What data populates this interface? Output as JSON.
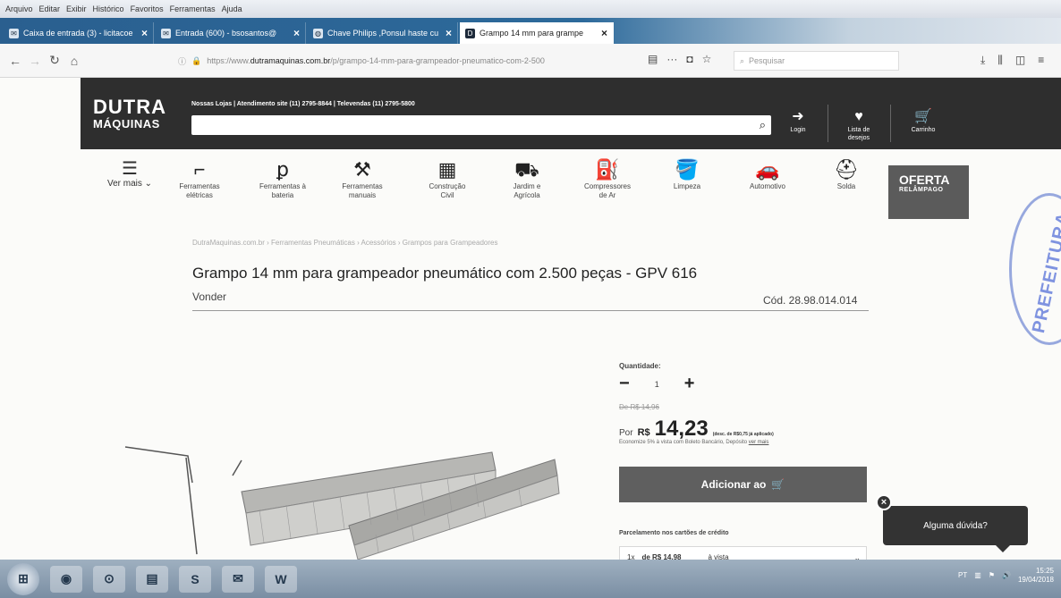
{
  "menubar": {
    "items": [
      "Arquivo",
      "Editar",
      "Exibir",
      "Histórico",
      "Favoritos",
      "Ferramentas",
      "Ajuda"
    ]
  },
  "tabs": [
    {
      "title": "Caixa de entrada (3) - licitacoe"
    },
    {
      "title": "Entrada (600) - bsosantos@"
    },
    {
      "title": "Chave Philips ,Ponsul haste cu"
    },
    {
      "title": "Grampo 14 mm para grampe"
    }
  ],
  "navbar": {
    "url_prefix": "https://www.",
    "url_domain": "dutramaquinas.com.br",
    "url_path": "/p/grampo-14-mm-para-grampeador-pneumatico-com-2-500",
    "search_placeholder": "Pesquisar"
  },
  "site": {
    "logo_line1": "DUTRA",
    "logo_line2": "MÁQUINAS",
    "toplinks": "Nossas Lojas  |  Atendimento site (11) 2795-8844  |  Televendas (11) 2795-5800",
    "search_value": "",
    "login": "Login",
    "wishlist_line1": "Lista de",
    "wishlist_line2": "desejos",
    "cart": "Carrinho"
  },
  "categories": {
    "ver_mais": "Ver mais",
    "items": [
      {
        "l1": "Ferramentas",
        "l2": "elétricas",
        "icon": "drill-icon"
      },
      {
        "l1": "Ferramentas à",
        "l2": "bateria",
        "icon": "battery-drill-icon"
      },
      {
        "l1": "Ferramentas",
        "l2": "manuais",
        "icon": "hand-tools-icon"
      },
      {
        "l1": "Construção",
        "l2": "Civil",
        "icon": "bricks-icon"
      },
      {
        "l1": "Jardim e",
        "l2": "Agrícola",
        "icon": "mower-icon"
      },
      {
        "l1": "Compressores",
        "l2": "de Ar",
        "icon": "compressor-icon"
      },
      {
        "l1": "Limpeza",
        "l2": "",
        "icon": "bucket-icon"
      },
      {
        "l1": "Automotivo",
        "l2": "",
        "icon": "car-icon"
      },
      {
        "l1": "Solda",
        "l2": "",
        "icon": "welding-mask-icon"
      }
    ],
    "oferta_line1": "OFERTA",
    "oferta_line2": "RELÂMPAGO"
  },
  "product": {
    "breadcrumb": "DutraMaquinas.com.br › Ferramentas Pneumáticas › Acessórios › Grampos para Grampeadores",
    "title": "Grampo 14 mm para grampeador pneumático com 2.500 peças - GPV 616",
    "brand": "Vonder",
    "code": "Cód. 28.98.014.014",
    "qty_label": "Quantidade:",
    "qty_value": "1",
    "old_price": "De R$ 14,96",
    "price_por": "Por",
    "price_currency": "R$",
    "price_value": "14,23",
    "price_note": "(desc. de R$0,75 já aplicado)",
    "discount_text": "Economize 5% à vista com Boleto Bancário, Depósito",
    "discount_link": "ver mais",
    "add_button": "Adicionar ao",
    "installments_label": "Parcelamento nos cartões de crédito",
    "installment_n": "1x",
    "installment_value": "de R$ 14,98",
    "installment_cond": "à vista"
  },
  "chat": {
    "close": "×",
    "text": "Alguma dúvida?"
  },
  "stamp": {
    "text": "PREFEITURA"
  },
  "taskbar": {
    "apps": [
      "⊞",
      "◉",
      "⊙",
      "▤",
      "S",
      "✉",
      "W"
    ],
    "lang": "PT",
    "time": "15:25",
    "date": "19/04/2018"
  }
}
